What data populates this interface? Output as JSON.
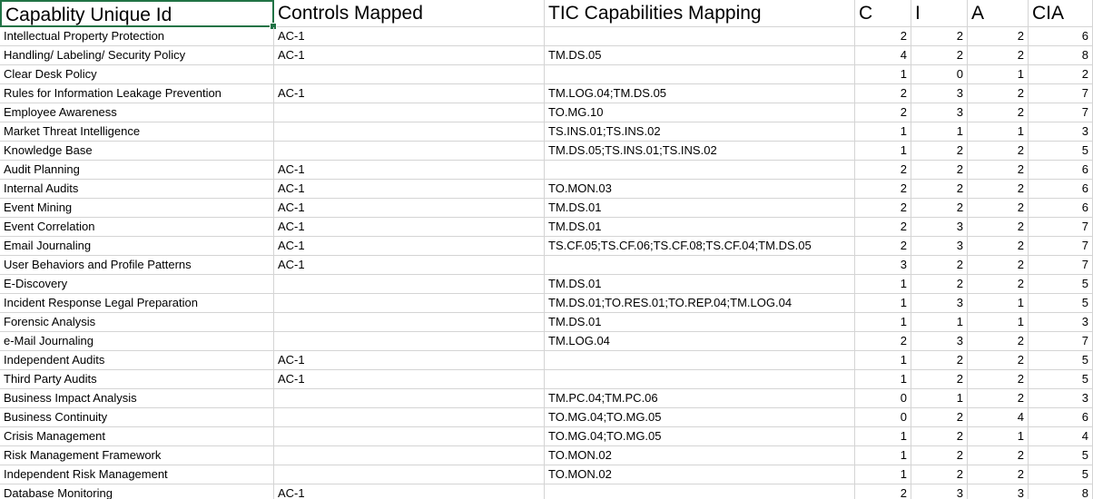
{
  "headers": [
    "Capablity Unique Id",
    "Controls Mapped",
    "TIC Capabilities Mapping",
    "C",
    "I",
    "A",
    "CIA"
  ],
  "rows": [
    [
      "Intellectual Property Protection",
      "AC-1",
      "",
      "2",
      "2",
      "2",
      "6"
    ],
    [
      "Handling/ Labeling/ Security Policy",
      "AC-1",
      "TM.DS.05",
      "4",
      "2",
      "2",
      "8"
    ],
    [
      "Clear Desk Policy",
      "",
      "",
      "1",
      "0",
      "1",
      "2"
    ],
    [
      "Rules for Information Leakage Prevention",
      "AC-1",
      "TM.LOG.04;TM.DS.05",
      "2",
      "3",
      "2",
      "7"
    ],
    [
      "Employee Awareness",
      "",
      "TO.MG.10",
      "2",
      "3",
      "2",
      "7"
    ],
    [
      "Market Threat Intelligence",
      "",
      "TS.INS.01;TS.INS.02",
      "1",
      "1",
      "1",
      "3"
    ],
    [
      "Knowledge Base",
      "",
      "TM.DS.05;TS.INS.01;TS.INS.02",
      "1",
      "2",
      "2",
      "5"
    ],
    [
      "Audit Planning",
      "AC-1",
      "",
      "2",
      "2",
      "2",
      "6"
    ],
    [
      "Internal Audits",
      "AC-1",
      "TO.MON.03",
      "2",
      "2",
      "2",
      "6"
    ],
    [
      "Event Mining",
      "AC-1",
      "TM.DS.01",
      "2",
      "2",
      "2",
      "6"
    ],
    [
      "Event Correlation",
      "AC-1",
      "TM.DS.01",
      "2",
      "3",
      "2",
      "7"
    ],
    [
      "Email Journaling",
      "AC-1",
      "TS.CF.05;TS.CF.06;TS.CF.08;TS.CF.04;TM.DS.05",
      "2",
      "3",
      "2",
      "7"
    ],
    [
      "User Behaviors and Profile Patterns",
      "AC-1",
      "",
      "3",
      "2",
      "2",
      "7"
    ],
    [
      "E-Discovery",
      "",
      "TM.DS.01",
      "1",
      "2",
      "2",
      "5"
    ],
    [
      "Incident Response Legal Preparation",
      "",
      "TM.DS.01;TO.RES.01;TO.REP.04;TM.LOG.04",
      "1",
      "3",
      "1",
      "5"
    ],
    [
      "Forensic Analysis",
      "",
      "TM.DS.01",
      "1",
      "1",
      "1",
      "3"
    ],
    [
      "e-Mail Journaling",
      "",
      "TM.LOG.04",
      "2",
      "3",
      "2",
      "7"
    ],
    [
      "Independent Audits",
      "AC-1",
      "",
      "1",
      "2",
      "2",
      "5"
    ],
    [
      "Third Party Audits",
      "AC-1",
      "",
      "1",
      "2",
      "2",
      "5"
    ],
    [
      "Business Impact Analysis",
      "",
      "TM.PC.04;TM.PC.06",
      "0",
      "1",
      "2",
      "3"
    ],
    [
      "Business Continuity",
      "",
      "TO.MG.04;TO.MG.05",
      "0",
      "2",
      "4",
      "6"
    ],
    [
      "Crisis Management",
      "",
      "TO.MG.04;TO.MG.05",
      "1",
      "2",
      "1",
      "4"
    ],
    [
      "Risk Management Framework",
      "",
      "TO.MON.02",
      "1",
      "2",
      "2",
      "5"
    ],
    [
      "Independent Risk Management",
      "",
      "TO.MON.02",
      "1",
      "2",
      "2",
      "5"
    ],
    [
      "Database Monitoring",
      "AC-1",
      "",
      "2",
      "3",
      "3",
      "8"
    ]
  ]
}
